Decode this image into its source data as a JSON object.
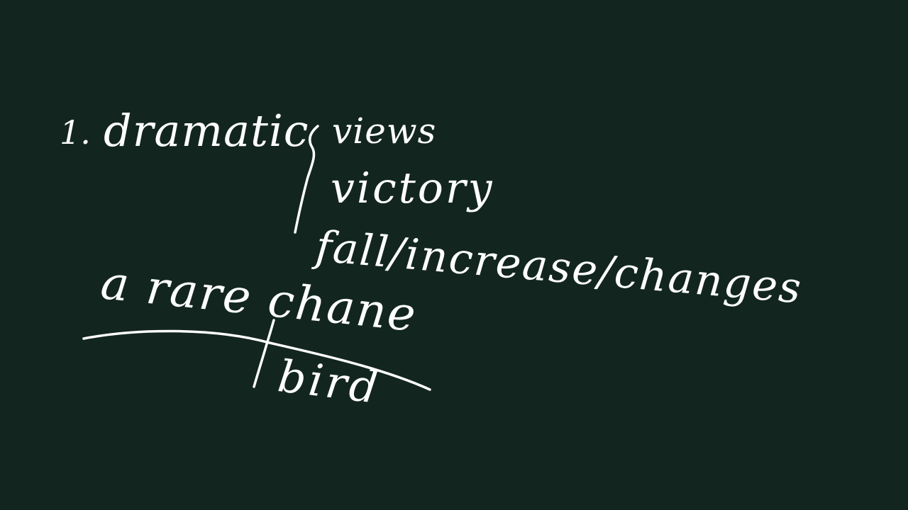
{
  "board": {
    "background_color": "#12261f",
    "ink_color": "#ffffff",
    "line1": {
      "number": "1.",
      "word": "dramatic",
      "options": [
        "views",
        "victory",
        "fall/increase/changes"
      ]
    },
    "line2": {
      "phrase": "a rare chane",
      "annotation": "bird"
    }
  }
}
